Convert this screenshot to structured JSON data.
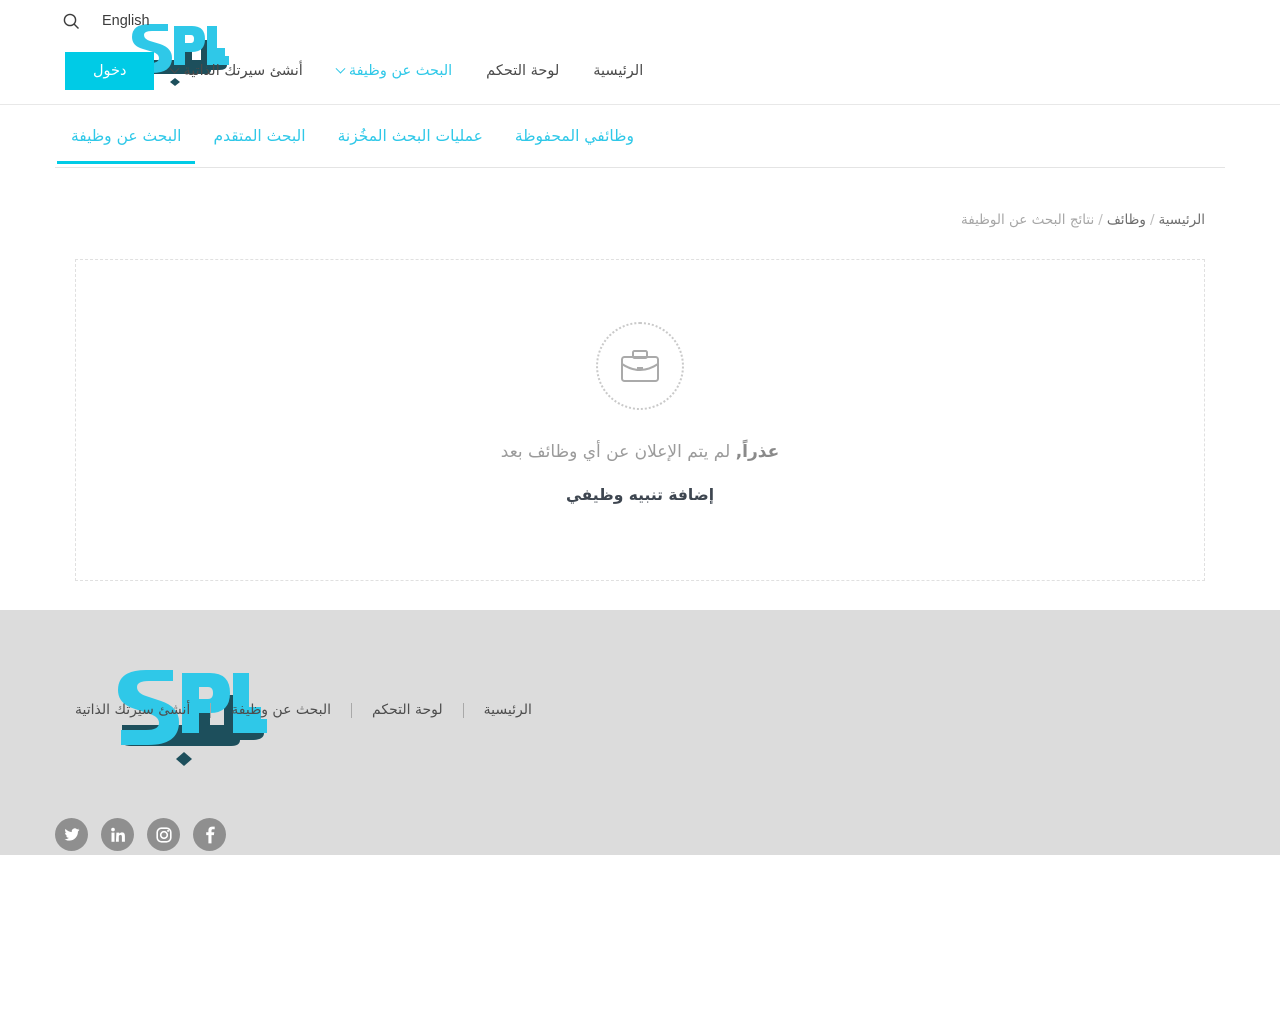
{
  "brand": {
    "logo_alt": "SPL",
    "logo_latin": "SPL",
    "logo_arabic": "سبل",
    "accent_color": "#2fc8e8",
    "dark_color": "#1d4f5c",
    "button_color": "#00cbe6"
  },
  "header": {
    "search_icon": "search-icon",
    "language_label": "English",
    "login_label": "دخول",
    "nav": [
      {
        "label": "الرئيسية",
        "accent": false,
        "caret": false
      },
      {
        "label": "لوحة التحكم",
        "accent": false,
        "caret": false
      },
      {
        "label": "البحث عن وظيفة",
        "accent": true,
        "caret": true
      },
      {
        "label": "أنشئ سيرتك الذاتية",
        "accent": false,
        "caret": true
      }
    ]
  },
  "tabs": [
    {
      "label": "البحث عن وظيفة",
      "active": true
    },
    {
      "label": "البحث المتقدم",
      "active": false
    },
    {
      "label": "عمليات البحث المخُزنة",
      "active": false
    },
    {
      "label": "وظائفي المحفوظة",
      "active": false
    }
  ],
  "breadcrumb": {
    "items": [
      {
        "label": "الرئيسية",
        "link": true
      },
      {
        "label": "وظائف",
        "link": true
      },
      {
        "label": "نتائج البحث عن الوظيفة",
        "link": false
      }
    ],
    "separator": "/"
  },
  "empty_state": {
    "icon": "briefcase-icon",
    "message_bold": "عذراً,",
    "message_rest": " لم يتم الإعلان عن أي وظائف بعد",
    "alert_link_label": "إضافة تنبيه وظيفي"
  },
  "footer": {
    "links": [
      {
        "label": "الرئيسية"
      },
      {
        "label": "لوحة التحكم"
      },
      {
        "label": "البحث عن وظيفة"
      },
      {
        "label": "أنشئ سيرتك الذاتية"
      }
    ],
    "socials": [
      {
        "name": "facebook-icon",
        "glyph": "f"
      },
      {
        "name": "instagram-icon",
        "glyph": ""
      },
      {
        "name": "linkedin-icon",
        "glyph": "in"
      },
      {
        "name": "twitter-icon",
        "glyph": ""
      }
    ],
    "background_color": "#dcdcdc"
  }
}
